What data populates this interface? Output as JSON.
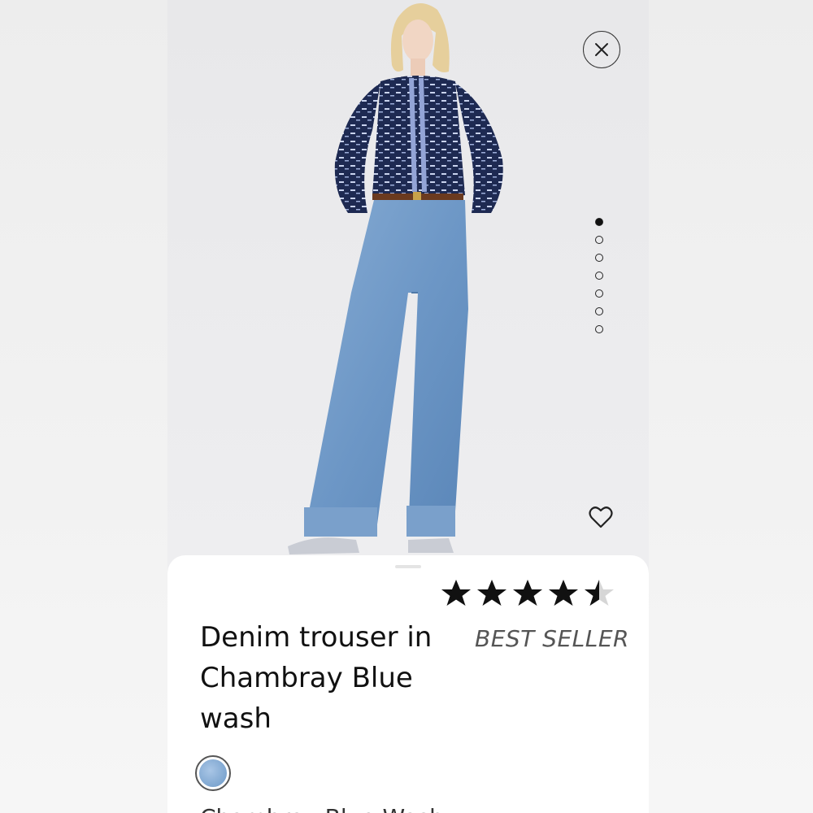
{
  "product": {
    "title": "Denim trouser in Chambray Blue wash",
    "badge": "BEST SELLER",
    "rating": 4.5,
    "color_name": "Chambray Blue Wash"
  },
  "gallery": {
    "total_images": 7,
    "active_index": 0
  },
  "icons": {
    "close": "close-icon",
    "favorite": "heart-icon",
    "star": "star-icon"
  },
  "colors": {
    "swatch": "#8fb2d9",
    "star_filled": "#111111",
    "star_empty": "#d6d6d6"
  }
}
